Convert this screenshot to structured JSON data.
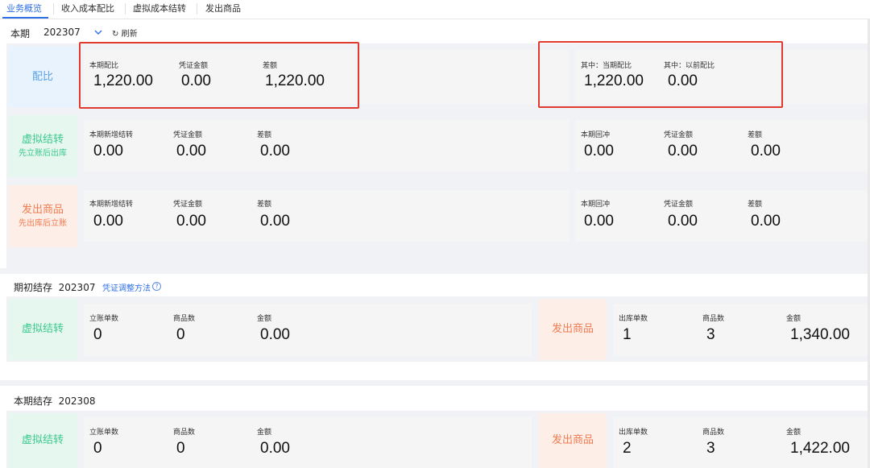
{
  "tabs": [
    "业务概览",
    "收入成本配比",
    "虚拟成本结转",
    "发出商品"
  ],
  "period": {
    "label": "本期",
    "value": "202307",
    "refresh_label": "刷新"
  },
  "match_row": {
    "label": "配比",
    "left": [
      {
        "label": "本期配比",
        "value": "1,220.00"
      },
      {
        "label": "凭证金额",
        "value": "0.00"
      },
      {
        "label": "差额",
        "value": "1,220.00"
      }
    ],
    "right": [
      {
        "label": "其中：当期配比",
        "value": "1,220.00"
      },
      {
        "label": "其中：以前配比",
        "value": "0.00"
      }
    ]
  },
  "virtual_row": {
    "label": "虚拟结转",
    "sublabel": "先立账后出库",
    "left": [
      {
        "label": "本期新增结转",
        "value": "0.00"
      },
      {
        "label": "凭证金额",
        "value": "0.00"
      },
      {
        "label": "差额",
        "value": "0.00"
      }
    ],
    "right": [
      {
        "label": "本期回冲",
        "value": "0.00"
      },
      {
        "label": "凭证金额",
        "value": "0.00"
      },
      {
        "label": "差额",
        "value": "0.00"
      }
    ]
  },
  "shipped_row": {
    "label": "发出商品",
    "sublabel": "先出库后立账",
    "left": [
      {
        "label": "本期新增结转",
        "value": "0.00"
      },
      {
        "label": "凭证金额",
        "value": "0.00"
      },
      {
        "label": "差额",
        "value": "0.00"
      }
    ],
    "right": [
      {
        "label": "本期回冲",
        "value": "0.00"
      },
      {
        "label": "凭证金额",
        "value": "0.00"
      },
      {
        "label": "差额",
        "value": "0.00"
      }
    ]
  },
  "opening": {
    "title": "期初结存",
    "period": "202307",
    "link": "凭证调整方法",
    "virtual_label": "虚拟结转",
    "virtual": [
      {
        "label": "立账单数",
        "value": "0"
      },
      {
        "label": "商品数",
        "value": "0"
      },
      {
        "label": "金额",
        "value": "0.00"
      }
    ],
    "shipped_label": "发出商品",
    "shipped": [
      {
        "label": "出库单数",
        "value": "1"
      },
      {
        "label": "商品数",
        "value": "3"
      },
      {
        "label": "金额",
        "value": "1,340.00"
      }
    ]
  },
  "closing": {
    "title": "本期结存",
    "period": "202308",
    "virtual_label": "虚拟结转",
    "virtual": [
      {
        "label": "立账单数",
        "value": "0"
      },
      {
        "label": "商品数",
        "value": "0"
      },
      {
        "label": "金额",
        "value": "0.00"
      }
    ],
    "shipped_label": "发出商品",
    "shipped": [
      {
        "label": "出库单数",
        "value": "2"
      },
      {
        "label": "商品数",
        "value": "3"
      },
      {
        "label": "金额",
        "value": "1,422.00"
      }
    ]
  },
  "colors": {
    "accent": "#2f6fe4",
    "highlight_border": "#e03b2e",
    "green": "#3cc98c",
    "orange": "#f07c52",
    "blue": "#5aa2e6"
  }
}
